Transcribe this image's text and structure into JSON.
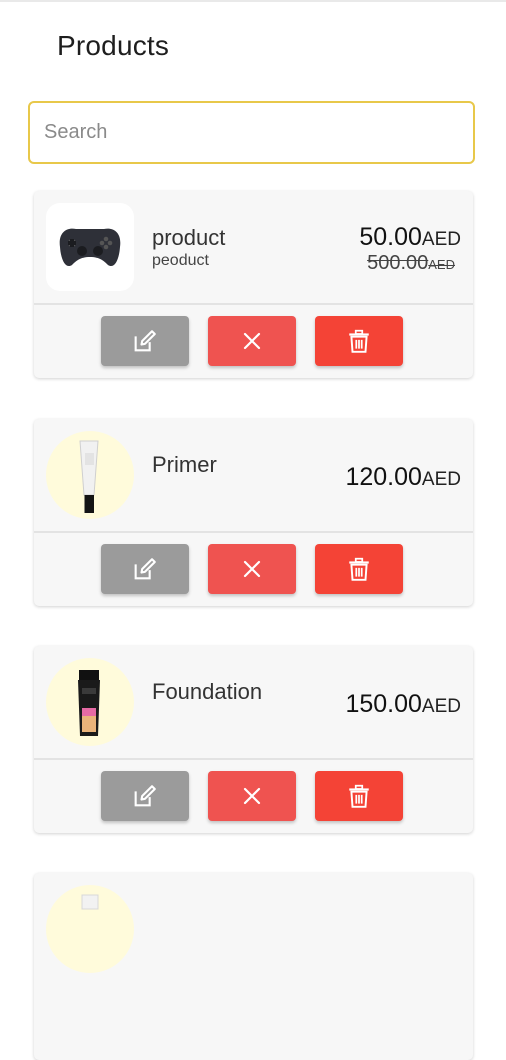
{
  "header": {
    "title": "Products"
  },
  "search": {
    "placeholder": "Search",
    "value": ""
  },
  "colors": {
    "edit": "#9b9b9b",
    "cancel": "#ef5350",
    "delete": "#f44336",
    "search_border": "#e8c84a"
  },
  "products": [
    {
      "name": "product",
      "subtitle": "peoduct",
      "price": "50.00",
      "currency": "AED",
      "old_price": "500.00",
      "old_currency": "AED",
      "image": "gamepad-image"
    },
    {
      "name": "Primer",
      "price": "120.00",
      "currency": "AED",
      "image": "primer-tube-image"
    },
    {
      "name": "Foundation",
      "price": "150.00",
      "currency": "AED",
      "image": "foundation-bottle-image"
    }
  ],
  "actions": {
    "edit_icon": "edit-icon",
    "cancel_icon": "close-icon",
    "delete_icon": "trash-icon"
  }
}
